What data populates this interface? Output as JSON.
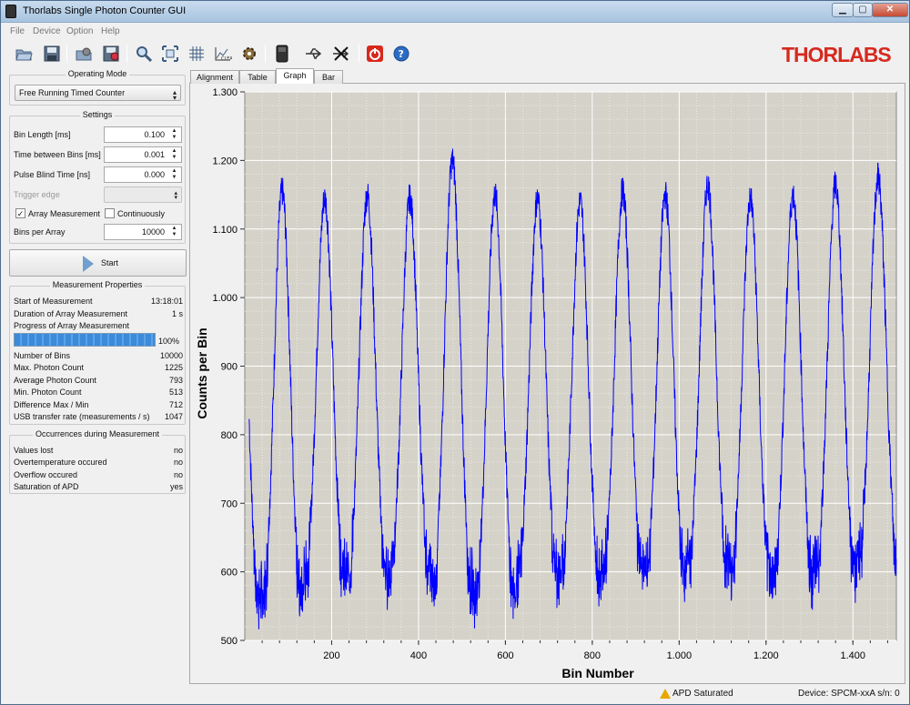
{
  "window": {
    "title": "Thorlabs Single Photon Counter GUI",
    "controls": {
      "minimize": "▁",
      "maximize": "▢",
      "close": "✕"
    }
  },
  "menu": {
    "items": [
      "File",
      "Device",
      "Option",
      "Help"
    ]
  },
  "toolbar": {
    "icons": [
      "open-folder-icon",
      "save-icon",
      "open-settings-icon",
      "save-settings-icon",
      "zoom-icon",
      "fit-view-icon",
      "grid-icon",
      "clear-graph-icon",
      "settings-gear-icon",
      "device-icon",
      "usb-connect-icon",
      "usb-disconnect-icon",
      "power-off-icon",
      "help-icon"
    ]
  },
  "logo": {
    "text": "THORLABS",
    "color": "#d62a1f"
  },
  "operating_mode": {
    "title": "Operating Mode",
    "selected": "Free Running Timed Counter"
  },
  "settings": {
    "title": "Settings",
    "bin_length_label": "Bin Length [ms]",
    "bin_length_value": "0.100",
    "time_between_bins_label": "Time between Bins [ms]",
    "time_between_bins_value": "0.001",
    "pulse_blind_time_label": "Pulse Blind Time [ns]",
    "pulse_blind_time_value": "0.000",
    "trigger_edge_label": "Trigger edge",
    "array_measurement_label": "Array Measurement",
    "array_measurement_checked": true,
    "continuously_label": "Continuously",
    "continuously_checked": false,
    "bins_per_array_label": "Bins per Array",
    "bins_per_array_value": "10000"
  },
  "start_button": {
    "label": "Start"
  },
  "measurement_properties": {
    "title": "Measurement Properties",
    "start_label": "Start of Measurement",
    "start_value": "13:18:01",
    "duration_label": "Duration of Array Measurement",
    "duration_value": "1 s",
    "progress_label": "Progress of Array Measurement",
    "progress_percent": 100,
    "progress_text": "100%",
    "rows": [
      {
        "label": "Number of Bins",
        "value": "10000"
      },
      {
        "label": "Max. Photon Count",
        "value": "1225"
      },
      {
        "label": "Average Photon Count",
        "value": "793"
      },
      {
        "label": "Min. Photon Count",
        "value": "513"
      },
      {
        "label": "Difference Max / Min",
        "value": "712"
      },
      {
        "label": "USB transfer rate (measurements / s)",
        "value": "1047"
      }
    ]
  },
  "occurrences": {
    "title": "Occurrences during Measurement",
    "rows": [
      {
        "label": "Values lost",
        "value": "no"
      },
      {
        "label": "Overtemperature occured",
        "value": "no"
      },
      {
        "label": "Overflow occured",
        "value": "no"
      },
      {
        "label": "Saturation of APD",
        "value": "yes"
      }
    ]
  },
  "tabs": [
    "Alignment",
    "Table",
    "Graph",
    "Bar"
  ],
  "active_tab": "Graph",
  "chart_data": {
    "type": "line",
    "xlabel": "Bin Number",
    "ylabel": "Counts per Bin",
    "xlim": [
      0,
      1500
    ],
    "ylim": [
      500,
      1300
    ],
    "x_ticks": [
      200,
      400,
      600,
      800,
      1000,
      1200,
      1400
    ],
    "x_tick_labels": [
      "200",
      "400",
      "600",
      "800",
      "1.000",
      "1.200",
      "1.400"
    ],
    "y_ticks": [
      500,
      600,
      700,
      800,
      900,
      1000,
      1100,
      1200,
      1300
    ],
    "y_tick_labels": [
      "500",
      "600",
      "700",
      "800",
      "900",
      "1.000",
      "1.100",
      "1.200",
      "1.300"
    ],
    "grid": true,
    "series_color": "#0000ff",
    "background": "#d5d2c9",
    "x_start": 10,
    "x_end": 1500,
    "period": 98,
    "first_peak_x": 86,
    "peaks": [
      1155,
      1145,
      1150,
      1145,
      1200,
      1150,
      1145,
      1140,
      1155,
      1150,
      1165,
      1145,
      1150,
      1165,
      1175
    ],
    "troughs": [
      525,
      560,
      555,
      565,
      540,
      530,
      560,
      555,
      565,
      560,
      575,
      560,
      555,
      565,
      580
    ]
  },
  "status": {
    "warning": "APD Saturated",
    "device": "Device: SPCM-xxA   s/n: 0"
  }
}
